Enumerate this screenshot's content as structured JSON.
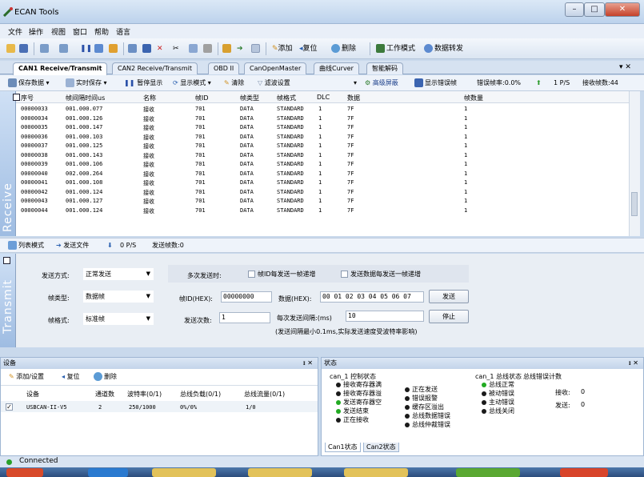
{
  "app": {
    "title": "ECAN Tools",
    "min": "–",
    "max": "□",
    "close": "✕"
  },
  "menu": [
    "文件",
    "操作",
    "视图",
    "窗口",
    "帮助",
    "语言"
  ],
  "toolbar": {
    "add": "添加",
    "reset": "复位",
    "delete": "删除",
    "work_mode": "工作模式",
    "forward": "数据转发"
  },
  "tabs": [
    "CAN1 Receive/Transmit",
    "CAN2 Receive/Transmit",
    "OBD II",
    "CanOpenMaster",
    "曲线Curver",
    "智能解码"
  ],
  "tab_close": "▾ ✕",
  "subbar": {
    "save": "保存数据",
    "realtime": "实时保存",
    "pause": "暂停显示",
    "display_mode": "显示模式",
    "clear": "清除",
    "filter": "滤波设置",
    "advanced": "高级屏蔽",
    "show_errors": "显示错误帧",
    "error_rate": "错误帧率:0.0%",
    "fps": "1 P/S",
    "rx_count": "接收帧数:44"
  },
  "receive": {
    "side": "Receive",
    "headers": [
      "序号",
      "帧间隔时间us",
      "名称",
      "帧ID",
      "帧类型",
      "帧格式",
      "DLC",
      "数据",
      "帧数量"
    ],
    "rows": [
      [
        "00000033",
        "001.000.077",
        "接收",
        "701",
        "DATA",
        "STANDARD",
        "1",
        "7F",
        "1"
      ],
      [
        "00000034",
        "001.000.126",
        "接收",
        "701",
        "DATA",
        "STANDARD",
        "1",
        "7F",
        "1"
      ],
      [
        "00000035",
        "001.000.147",
        "接收",
        "701",
        "DATA",
        "STANDARD",
        "1",
        "7F",
        "1"
      ],
      [
        "00000036",
        "001.000.103",
        "接收",
        "701",
        "DATA",
        "STANDARD",
        "1",
        "7F",
        "1"
      ],
      [
        "00000037",
        "001.000.125",
        "接收",
        "701",
        "DATA",
        "STANDARD",
        "1",
        "7F",
        "1"
      ],
      [
        "00000038",
        "001.000.143",
        "接收",
        "701",
        "DATA",
        "STANDARD",
        "1",
        "7F",
        "1"
      ],
      [
        "00000039",
        "001.000.106",
        "接收",
        "701",
        "DATA",
        "STANDARD",
        "1",
        "7F",
        "1"
      ],
      [
        "00000040",
        "002.000.264",
        "接收",
        "701",
        "DATA",
        "STANDARD",
        "1",
        "7F",
        "1"
      ],
      [
        "00000041",
        "001.000.108",
        "接收",
        "701",
        "DATA",
        "STANDARD",
        "1",
        "7F",
        "1"
      ],
      [
        "00000042",
        "001.000.124",
        "接收",
        "701",
        "DATA",
        "STANDARD",
        "1",
        "7F",
        "1"
      ],
      [
        "00000043",
        "001.000.127",
        "接收",
        "701",
        "DATA",
        "STANDARD",
        "1",
        "7F",
        "1"
      ],
      [
        "00000044",
        "001.000.124",
        "接收",
        "701",
        "DATA",
        "STANDARD",
        "1",
        "7F",
        "1"
      ]
    ]
  },
  "sendbar": {
    "list_mode": "列表模式",
    "send_file": "发送文件",
    "rate": "0 P/S",
    "sent": "发送帧数:0"
  },
  "send": {
    "side": "Transmit",
    "mode_label": "发送方式:",
    "mode": "正常发送",
    "multi_label": "多次发送时:",
    "inc_id": "帧ID每发送一帧递增",
    "inc_data": "发送数据每发送一帧递增",
    "type_label": "帧类型:",
    "type": "数据帧",
    "id_label": "帧ID(HEX):",
    "id": "00000000",
    "data_label": "数据(HEX):",
    "data": "00 01 02 03 04 05 06 07",
    "send_btn": "发送",
    "format_label": "帧格式:",
    "format": "标准帧",
    "count_label": "发送次数:",
    "count": "1",
    "interval_label": "每次发送间隔:(ms)",
    "interval": "10",
    "stop_btn": "停止",
    "note": "(发送间隔最小0.1ms,实际发送速度受波特率影响)"
  },
  "device": {
    "title": "设备",
    "pin": "ᵻ ✕",
    "add": "添加/设置",
    "reset": "复位",
    "delete": "删除",
    "headers": [
      "设备",
      "通道数",
      "波特率(0/1)",
      "总线负载(0/1)",
      "总线流量(0/1)"
    ],
    "row": [
      "USBCAN-II-V5",
      "2",
      "250/1000",
      "0%/0%",
      "1/0"
    ]
  },
  "status": {
    "title": "状态",
    "pin": "ᵻ ✕",
    "ctrl_title": "can_1 控制状态",
    "bus_title": "can_1 总线状态",
    "err_title": "总线错误计数",
    "ctrl": [
      [
        "接收寄存器满",
        "#1a1a1a"
      ],
      [
        "接收寄存器溢",
        "#1a1a1a"
      ],
      [
        "发送寄存器空",
        "#22aa22"
      ],
      [
        "发送结束",
        "#22aa22"
      ],
      [
        "正在接收",
        "#1a1a1a"
      ]
    ],
    "ctrl2": [
      [
        "正在发送",
        "#1a1a1a"
      ],
      [
        "错误报警",
        "#1a1a1a"
      ],
      [
        "缓存区溢出",
        "#1a1a1a"
      ],
      [
        "总线数据错误",
        "#1a1a1a"
      ],
      [
        "总线仲裁错误",
        "#1a1a1a"
      ]
    ],
    "bus": [
      [
        "总线正常",
        "#22aa22"
      ],
      [
        "被动错误",
        "#1a1a1a"
      ],
      [
        "主动错误",
        "#1a1a1a"
      ],
      [
        "总线关闭",
        "#1a1a1a"
      ]
    ],
    "rx_label": "接收:",
    "rx": "0",
    "tx_label": "发送:",
    "tx": "0",
    "tabs": [
      "Can1状态",
      "Can2状态"
    ]
  },
  "statusbar": {
    "text": "Connected"
  }
}
